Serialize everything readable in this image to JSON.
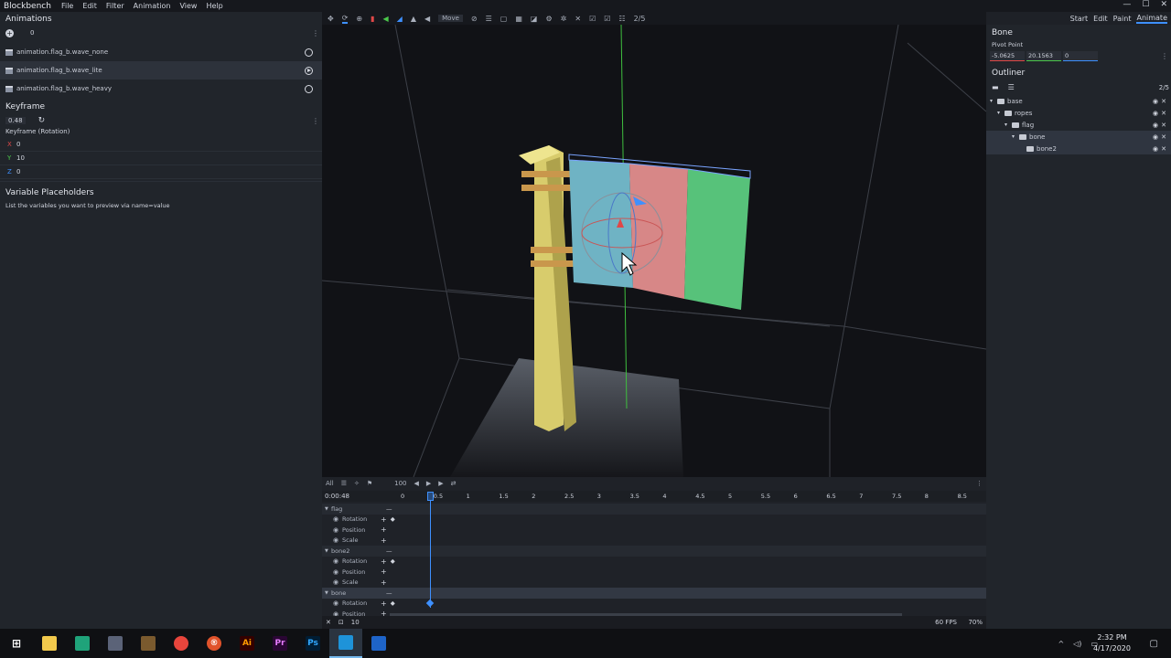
{
  "app": {
    "name": "Blockbench",
    "menu": [
      "File",
      "Edit",
      "Filter",
      "Animation",
      "View",
      "Help"
    ],
    "modes": [
      "Start",
      "Edit",
      "Paint",
      "Animate"
    ]
  },
  "animations": {
    "title": "Animations",
    "count": "0",
    "items": [
      {
        "name": "animation.flag_b.wave_none"
      },
      {
        "name": "animation.flag_b.wave_lite"
      },
      {
        "name": "animation.flag_b.wave_heavy"
      }
    ]
  },
  "keyframe": {
    "title": "Keyframe",
    "time": "0.48",
    "channel": "Keyframe (Rotation)",
    "x": "0",
    "y": "10",
    "z": "0"
  },
  "variables": {
    "title": "Variable Placeholders",
    "hint": "List the variables you want to preview via name=value"
  },
  "toolbar": {
    "move_label": "Move",
    "counter": "2/5"
  },
  "bone": {
    "title": "Bone",
    "pivot_label": "Pivot Point",
    "pivot": [
      "-5.0625",
      "20.1563",
      "0"
    ]
  },
  "outliner": {
    "title": "Outliner",
    "counter": "2/5",
    "items": [
      {
        "name": "base",
        "depth": 0
      },
      {
        "name": "ropes",
        "depth": 1
      },
      {
        "name": "flag",
        "depth": 2
      },
      {
        "name": "bone",
        "depth": 3
      },
      {
        "name": "bone2",
        "depth": 4
      }
    ]
  },
  "timeline": {
    "filter": "All",
    "zoom": "100",
    "time": "0:00:48",
    "ticks": [
      "0",
      "0.5",
      "1",
      "1.5",
      "2",
      "2.5",
      "3",
      "3.5",
      "4",
      "4.5",
      "5",
      "5.5",
      "6",
      "6.5",
      "7",
      "7.5",
      "8",
      "8.5"
    ],
    "groups": [
      {
        "name": "flag",
        "channels": [
          "Rotation",
          "Position",
          "Scale"
        ]
      },
      {
        "name": "bone2",
        "channels": [
          "Rotation",
          "Position",
          "Scale"
        ]
      },
      {
        "name": "bone",
        "channels": [
          "Rotation",
          "Position"
        ]
      }
    ],
    "snap": "10",
    "fps": "60 FPS",
    "zoom_pct": "70%"
  },
  "taskbar": {
    "time": "2:32 PM",
    "date": "4/17/2020"
  }
}
